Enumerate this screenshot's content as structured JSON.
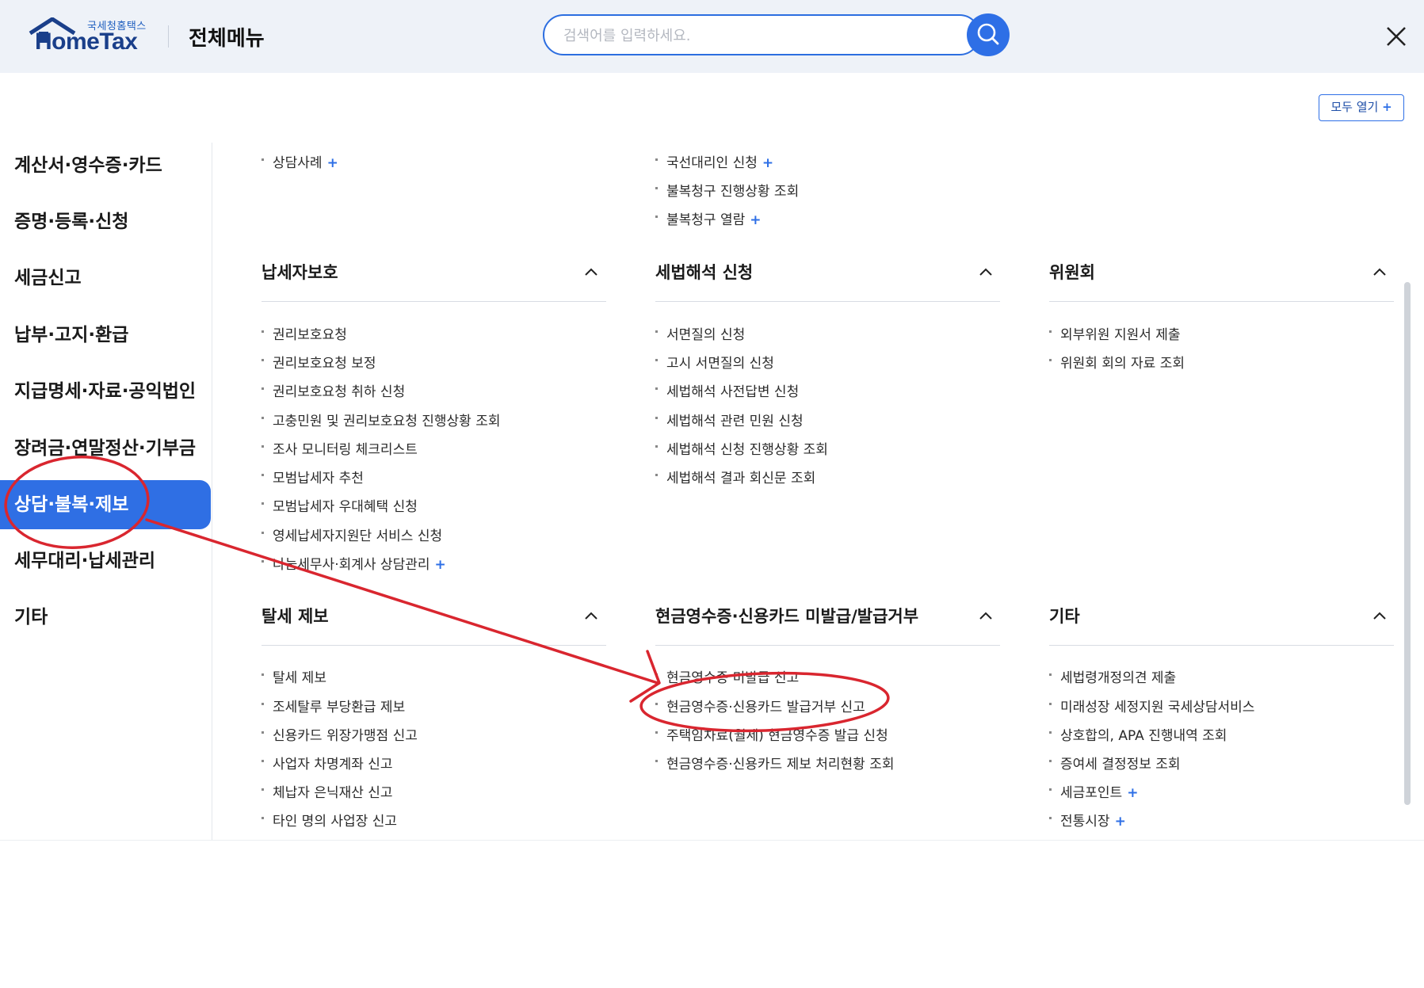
{
  "header": {
    "logo_sub": "국세청홈택스",
    "logo_main": "HomeTax",
    "title": "전체메뉴",
    "search_placeholder": "검색어를 입력하세요."
  },
  "open_all_label": "모두 열기",
  "sidebar": {
    "items": [
      {
        "label": "계산서·영수증·카드",
        "active": false
      },
      {
        "label": "증명·등록·신청",
        "active": false
      },
      {
        "label": "세금신고",
        "active": false
      },
      {
        "label": "납부·고지·환급",
        "active": false
      },
      {
        "label": "지급명세·자료·공익법인",
        "active": false
      },
      {
        "label": "장려금·연말정산·기부금",
        "active": false
      },
      {
        "label": "상담·불복·제보",
        "active": true
      },
      {
        "label": "세무대리·납세관리",
        "active": false
      },
      {
        "label": "기타",
        "active": false
      }
    ]
  },
  "top_items": {
    "col1": [
      {
        "label": "상담사례",
        "expandable": true
      }
    ],
    "col2": [
      {
        "label": "국선대리인 신청",
        "expandable": true
      },
      {
        "label": "불복청구 진행상황 조회",
        "expandable": false
      },
      {
        "label": "불복청구 열람",
        "expandable": true
      }
    ]
  },
  "sections": {
    "taxpayer_protection": {
      "title": "납세자보호",
      "items": [
        {
          "label": "권리보호요청",
          "expandable": false
        },
        {
          "label": "권리보호요청 보정",
          "expandable": false
        },
        {
          "label": "권리보호요청 취하 신청",
          "expandable": false
        },
        {
          "label": "고충민원 및 권리보호요청 진행상황 조회",
          "expandable": false
        },
        {
          "label": "조사 모니터링 체크리스트",
          "expandable": false
        },
        {
          "label": "모범납세자 추천",
          "expandable": false
        },
        {
          "label": "모범납세자 우대혜택 신청",
          "expandable": false
        },
        {
          "label": "영세납세자지원단 서비스 신청",
          "expandable": false
        },
        {
          "label": "나눔세무사·회계사 상담관리",
          "expandable": true
        }
      ]
    },
    "tax_interpretation": {
      "title": "세법해석 신청",
      "items": [
        {
          "label": "서면질의 신청",
          "expandable": false
        },
        {
          "label": "고시 서면질의 신청",
          "expandable": false
        },
        {
          "label": "세법해석 사전답변 신청",
          "expandable": false
        },
        {
          "label": "세법해석 관련 민원 신청",
          "expandable": false
        },
        {
          "label": "세법해석 신청 진행상황 조회",
          "expandable": false
        },
        {
          "label": "세법해석 결과 회신문 조회",
          "expandable": false
        }
      ]
    },
    "committee": {
      "title": "위원회",
      "items": [
        {
          "label": "외부위원 지원서 제출",
          "expandable": false
        },
        {
          "label": "위원회 회의 자료 조회",
          "expandable": false
        }
      ]
    },
    "tax_evasion_report": {
      "title": "탈세 제보",
      "items": [
        {
          "label": "탈세 제보",
          "expandable": false
        },
        {
          "label": "조세탈루 부당환급 제보",
          "expandable": false
        },
        {
          "label": "신용카드 위장가맹점 신고",
          "expandable": false
        },
        {
          "label": "사업자 차명계좌 신고",
          "expandable": false
        },
        {
          "label": "체납자 은닉재산 신고",
          "expandable": false
        },
        {
          "label": "타인 명의 사업장 신고",
          "expandable": false
        }
      ]
    },
    "cash_receipt": {
      "title": "현금영수증·신용카드 미발급/발급거부",
      "items": [
        {
          "label": "현금영수증 미발급 신고",
          "expandable": false
        },
        {
          "label": "현금영수증·신용카드 발급거부 신고",
          "expandable": false
        },
        {
          "label": "주택임차료(월세) 현금영수증 발급 신청",
          "expandable": false
        },
        {
          "label": "현금영수증·신용카드 제보 처리현황 조회",
          "expandable": false
        }
      ]
    },
    "etc": {
      "title": "기타",
      "items": [
        {
          "label": "세법령개정의견 제출",
          "expandable": false
        },
        {
          "label": "미래성장 세정지원 국세상담서비스",
          "expandable": false
        },
        {
          "label": "상호합의, APA 진행내역 조회",
          "expandable": false
        },
        {
          "label": "증여세 결정정보 조회",
          "expandable": false
        },
        {
          "label": "세금포인트",
          "expandable": true
        },
        {
          "label": "전통시장",
          "expandable": true
        }
      ]
    }
  },
  "colors": {
    "accent": "#2e6fe6",
    "annotation": "#d9262f"
  }
}
